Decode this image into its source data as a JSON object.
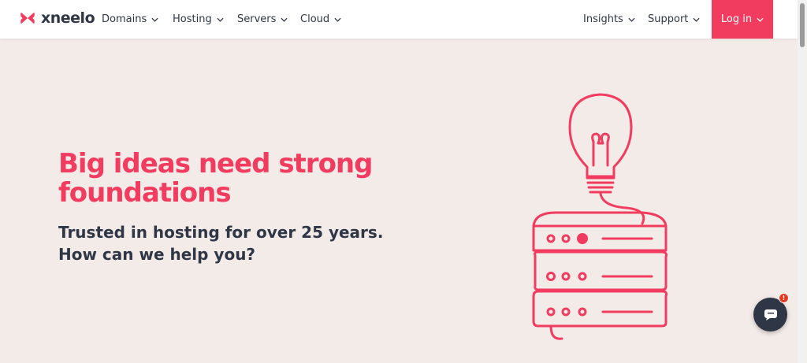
{
  "brand": {
    "name": "xneelo",
    "color": "#f23c5f",
    "dark": "#2f3645"
  },
  "nav": {
    "left": [
      {
        "label": "Domains"
      },
      {
        "label": "Hosting"
      },
      {
        "label": "Servers"
      },
      {
        "label": "Cloud"
      }
    ],
    "right": [
      {
        "label": "Insights"
      },
      {
        "label": "Support"
      }
    ],
    "login_label": "Log in"
  },
  "hero": {
    "headline_line1": "Big ideas need strong",
    "headline_line2": "foundations",
    "sub_line1": "Trusted in hosting for over 25 years.",
    "sub_line2": "How can we help you?",
    "illustration_icon": "lightbulb-server-stack-icon"
  },
  "chat": {
    "icon": "chat-icon",
    "badge": "!"
  }
}
